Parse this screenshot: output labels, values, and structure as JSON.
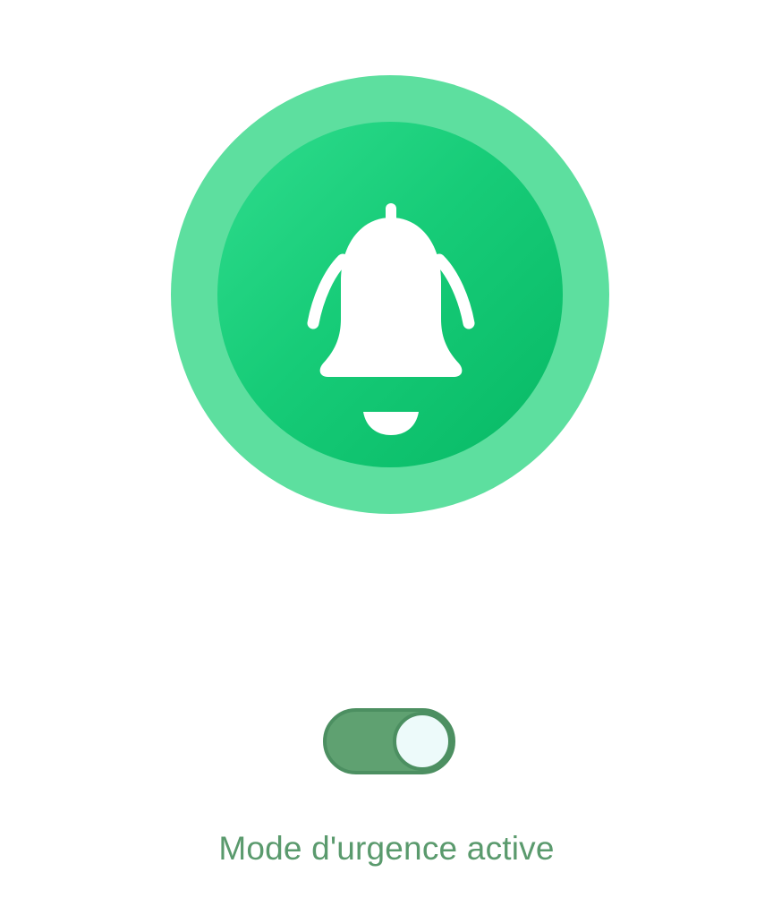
{
  "alarm": {
    "icon": "bell-ringing-icon",
    "colors": {
      "outer_ring": "#5ddf9f",
      "inner_circle": "#17cc78",
      "icon": "#ffffff"
    }
  },
  "toggle": {
    "state": "on",
    "colors": {
      "track": "#5fa171",
      "knob": "#edfafa",
      "border": "#4c8f61"
    }
  },
  "status": {
    "label": "Mode d'urgence active",
    "color": "#5a9a6d"
  }
}
